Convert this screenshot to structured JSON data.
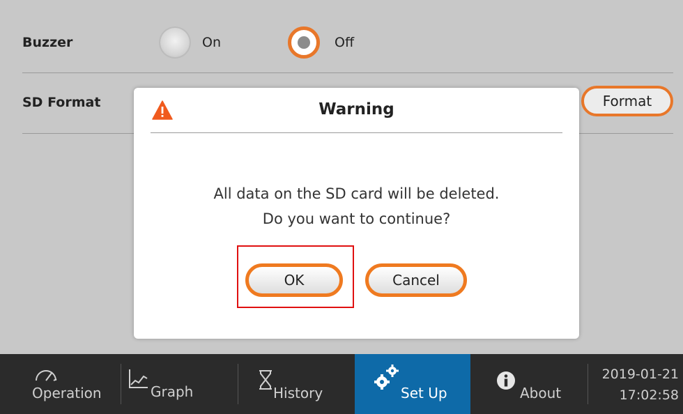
{
  "settings": {
    "buzzer": {
      "label": "Buzzer",
      "on_label": "On",
      "off_label": "Off",
      "selected": "Off"
    },
    "sd_format": {
      "label": "SD Format",
      "button_label": "Format"
    }
  },
  "dialog": {
    "title": "Warning",
    "message_line1": "All data on the SD card will be deleted.",
    "message_line2": "Do you want to continue?",
    "ok_label": "OK",
    "cancel_label": "Cancel",
    "icon": "warning-triangle-icon"
  },
  "nav": {
    "items": [
      {
        "label": "Operation",
        "icon": "gauge-icon"
      },
      {
        "label": "Graph",
        "icon": "line-chart-icon"
      },
      {
        "label": "History",
        "icon": "hourglass-icon"
      },
      {
        "label": "Set Up",
        "icon": "gears-icon"
      },
      {
        "label": "About",
        "icon": "info-icon"
      }
    ],
    "active": "Set Up",
    "date": "2019-01-21",
    "time": "17:02:58"
  },
  "colors": {
    "accent": "#e8772a",
    "active_tab": "#0e6aa8",
    "navbar": "#2b2b2b",
    "highlight": "#e01010",
    "warning": "#f05a1e"
  }
}
